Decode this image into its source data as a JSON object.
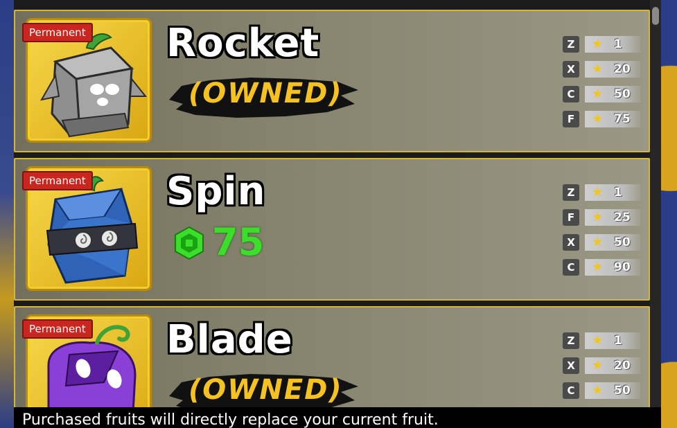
{
  "shop": {
    "items": [
      {
        "name": "Rocket",
        "badge": "Permanent",
        "status": "(OWNED)",
        "icon": "rocket-fruit-icon",
        "moves": [
          {
            "key": "Z",
            "level": "1"
          },
          {
            "key": "X",
            "level": "20"
          },
          {
            "key": "C",
            "level": "50"
          },
          {
            "key": "F",
            "level": "75"
          }
        ]
      },
      {
        "name": "Spin",
        "badge": "Permanent",
        "price": "75",
        "currency_icon": "robux-icon",
        "icon": "spin-fruit-icon",
        "moves": [
          {
            "key": "Z",
            "level": "1"
          },
          {
            "key": "F",
            "level": "25"
          },
          {
            "key": "X",
            "level": "50"
          },
          {
            "key": "C",
            "level": "90"
          }
        ]
      },
      {
        "name": "Blade",
        "badge": "Permanent",
        "status": "(OWNED)",
        "icon": "blade-fruit-icon",
        "moves": [
          {
            "key": "Z",
            "level": "1"
          },
          {
            "key": "X",
            "level": "20"
          },
          {
            "key": "C",
            "level": "50"
          }
        ]
      }
    ],
    "footer_note": "Purchased fruits will directly replace your current fruit."
  },
  "colors": {
    "card_border": "#d6b53c",
    "owned_text": "#f5c221",
    "price_text": "#3bde2a",
    "badge_bg": "#c8261f"
  }
}
